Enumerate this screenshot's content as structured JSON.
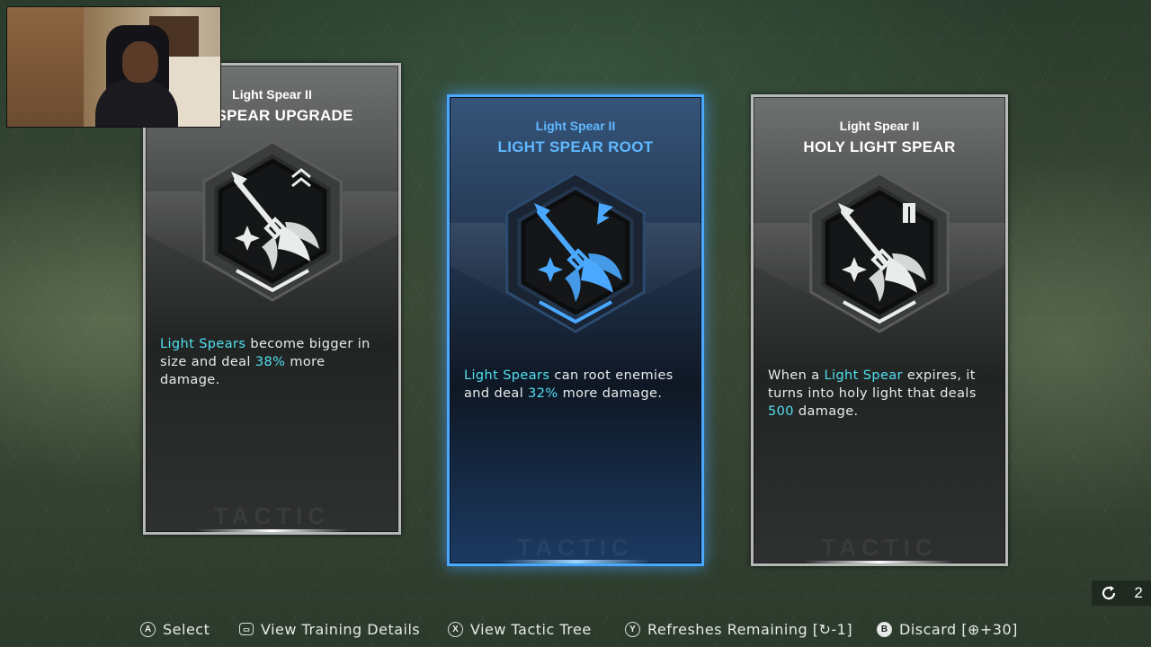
{
  "cards": [
    {
      "subtitle": "Light Spear II",
      "title": "HT SPEAR UPGRADE",
      "icon": "light-spear-upgrade-icon",
      "desc_parts": [
        {
          "text": "Light Spears",
          "highlight": true
        },
        {
          "text": " become bigger in size and deal ",
          "highlight": false
        },
        {
          "text": "38%",
          "highlight": true
        },
        {
          "text": " more damage.",
          "highlight": false
        }
      ],
      "watermark": "TACTIC",
      "selected": false
    },
    {
      "subtitle": "Light Spear II",
      "title": "LIGHT SPEAR ROOT",
      "icon": "light-spear-root-icon",
      "desc_parts": [
        {
          "text": "Light Spears",
          "highlight": true
        },
        {
          "text": " can root enemies and deal ",
          "highlight": false
        },
        {
          "text": "32%",
          "highlight": true
        },
        {
          "text": " more damage.",
          "highlight": false
        }
      ],
      "watermark": "TACTIC",
      "selected": true
    },
    {
      "subtitle": "Light Spear II",
      "title": "HOLY LIGHT SPEAR",
      "icon": "holy-light-spear-icon",
      "desc_parts": [
        {
          "text": "When a ",
          "highlight": false
        },
        {
          "text": "Light Spear",
          "highlight": true
        },
        {
          "text": " expires, it turns into holy light that deals ",
          "highlight": false
        },
        {
          "text": "500",
          "highlight": true
        },
        {
          "text": " damage.",
          "highlight": false
        }
      ],
      "watermark": "TACTIC",
      "selected": false
    }
  ],
  "refresh": {
    "icon": "refresh-icon",
    "count": "2"
  },
  "hints": [
    {
      "glyph": "A",
      "label": "Select",
      "name": "select-hint"
    },
    {
      "glyph": "▭",
      "label": "View Training Details",
      "name": "view-training-details-hint"
    },
    {
      "glyph": "X",
      "label": "View Tactic Tree",
      "name": "view-tactic-tree-hint"
    },
    {
      "glyph": "Y",
      "label": "Refreshes Remaining [↻-1]",
      "name": "refreshes-remaining-hint"
    },
    {
      "glyph": "B",
      "label": "Discard [⊕+30]",
      "name": "discard-hint"
    }
  ],
  "colors": {
    "highlight": "#4fe0f0",
    "selected_accent": "#4aa8ff",
    "card_border": "#b7b9b8"
  }
}
